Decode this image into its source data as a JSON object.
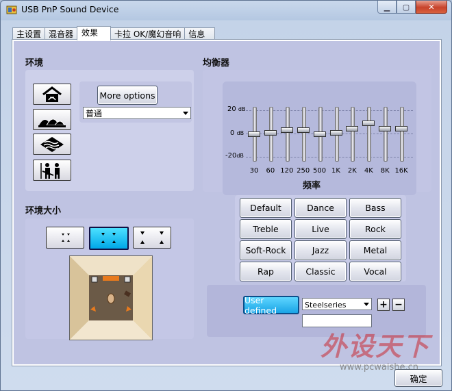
{
  "window": {
    "title": "USB PnP Sound Device"
  },
  "tabs": [
    {
      "label": "主设置",
      "active": false
    },
    {
      "label": "混音器",
      "active": false
    },
    {
      "label": "效果",
      "active": true
    },
    {
      "label": "卡拉 OK/魔幻音响",
      "active": false
    },
    {
      "label": "信息",
      "active": false
    }
  ],
  "environment": {
    "title": "环境",
    "more_options_label": "More options",
    "selected": "普通",
    "icons": [
      "home-icon",
      "opera-house-icon",
      "underwater-icon",
      "concert-icon"
    ]
  },
  "room_size": {
    "title": "环境大小",
    "options": [
      "small",
      "medium",
      "large"
    ],
    "selected_index": 1
  },
  "equalizer": {
    "title": "均衡器",
    "db_top": "20",
    "db_mid": "0",
    "db_bottom": "-20",
    "db_unit": "dB",
    "freq_title": "频率",
    "bands": [
      {
        "freq": "30",
        "level": 0
      },
      {
        "freq": "60",
        "level": 1
      },
      {
        "freq": "120",
        "level": 3
      },
      {
        "freq": "250",
        "level": 3
      },
      {
        "freq": "500",
        "level": 0
      },
      {
        "freq": "1K",
        "level": 1
      },
      {
        "freq": "2K",
        "level": 4
      },
      {
        "freq": "4K",
        "level": 8
      },
      {
        "freq": "8K",
        "level": 4
      },
      {
        "freq": "16K",
        "level": 4
      }
    ],
    "presets": [
      "Default",
      "Dance",
      "Bass",
      "Treble",
      "Live",
      "Rock",
      "Soft-Rock",
      "Jazz",
      "Metal",
      "Rap",
      "Classic",
      "Vocal"
    ],
    "user_defined_label": "User defined",
    "user_preset_selected": "Steelseries",
    "new_preset_name": "",
    "add_label": "+",
    "remove_label": "−"
  },
  "footer": {
    "ok_label": "确定"
  },
  "watermark": {
    "brand": "外设天下",
    "url": "www.pcwaishe.cn"
  },
  "colors": {
    "active_accent": "#1aa4e6",
    "panel": "#cdd0ea",
    "tab_background": "#bfc3e2"
  }
}
